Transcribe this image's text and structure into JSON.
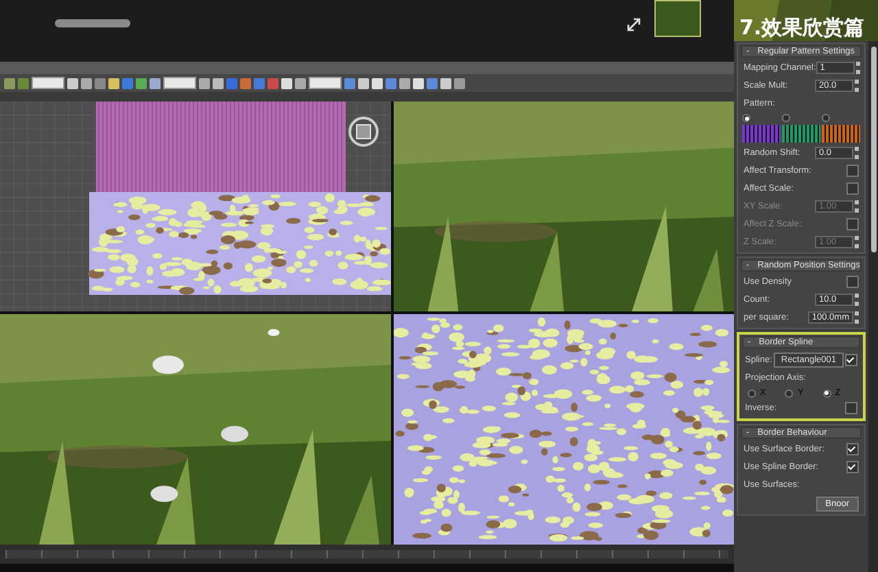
{
  "header": {
    "title": "7.效果欣赏篇"
  },
  "viewports": [
    {
      "kind": "wireframe"
    },
    {
      "kind": "grass"
    },
    {
      "kind": "grass_dandelion"
    },
    {
      "kind": "scatter"
    }
  ],
  "panel": {
    "rollouts": [
      {
        "title": "Regular Pattern Settings",
        "marker": "-",
        "highlighted": false,
        "rows": [
          {
            "kind": "spinner",
            "label": "Mapping Channel:",
            "value": "1",
            "disabled": false
          },
          {
            "kind": "spinner",
            "label": "Scale Mult:",
            "value": "20.0",
            "disabled": false
          },
          {
            "kind": "caption",
            "label": "Pattern:"
          },
          {
            "kind": "patterns",
            "items": [
              {
                "color": "#7a3ad0",
                "selected": true
              },
              {
                "color": "#1f9a64",
                "selected": false
              },
              {
                "color": "#c8641e",
                "selected": false
              }
            ]
          },
          {
            "kind": "spinner",
            "label": "Random Shift:",
            "value": "0.0",
            "disabled": false
          },
          {
            "kind": "check",
            "label": "Affect Transform:",
            "checked": false,
            "disabled": false
          },
          {
            "kind": "check",
            "label": "Affect Scale:",
            "checked": false,
            "disabled": false
          },
          {
            "kind": "spinner",
            "label": "XY Scale:",
            "value": "1.00",
            "disabled": true
          },
          {
            "kind": "check",
            "label": "Affect Z Scale:",
            "checked": false,
            "disabled": true
          },
          {
            "kind": "spinner",
            "label": "Z Scale:",
            "value": "1.00",
            "disabled": true
          }
        ]
      },
      {
        "title": "Random Position Settings",
        "marker": "-",
        "highlighted": false,
        "rows": [
          {
            "kind": "check",
            "label": "Use Density",
            "checked": false,
            "disabled": false
          },
          {
            "kind": "spinner",
            "label": "Count:",
            "value": "10.0",
            "disabled": false
          },
          {
            "kind": "spinner",
            "label": "per square:",
            "value": "100.0mm",
            "disabled": false
          }
        ]
      },
      {
        "title": "Border Spline",
        "marker": "-",
        "highlighted": true,
        "rows": [
          {
            "kind": "pick",
            "label": "Spline:",
            "value": "Rectangle001",
            "checked": true
          },
          {
            "kind": "caption",
            "label": "Projection Axis:"
          },
          {
            "kind": "radios",
            "items": [
              {
                "label": "X",
                "selected": false
              },
              {
                "label": "Y",
                "selected": false
              },
              {
                "label": "Z",
                "selected": true
              }
            ]
          },
          {
            "kind": "check",
            "label": "Inverse:",
            "checked": false,
            "disabled": false
          }
        ]
      },
      {
        "title": "Border Behaviour",
        "marker": "-",
        "highlighted": false,
        "rows": [
          {
            "kind": "check",
            "label": "Use Surface Border:",
            "checked": true,
            "disabled": false
          },
          {
            "kind": "check",
            "label": "Use Spline Border:",
            "checked": true,
            "disabled": false
          },
          {
            "kind": "caption",
            "label": "Use Surfaces:"
          },
          {
            "kind": "button",
            "label": "Bnoor"
          }
        ]
      }
    ]
  }
}
